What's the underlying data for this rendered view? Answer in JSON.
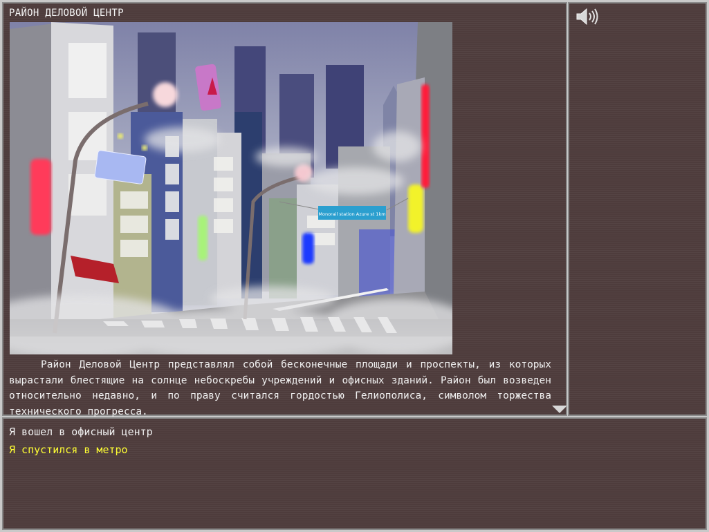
{
  "location": {
    "title": "РАЙОН ДЕЛОВОЙ ЦЕНТР"
  },
  "scene": {
    "signs": {
      "station": "Monorail station Azure st 1km"
    }
  },
  "description": "Район Деловой Центр представлял собой бесконечные площади и проспекты, из которых вырастали блестящие на солнце небоскребы учреждений и офисных зданий. Район был возведен относительно недавно, и по праву считался гордостью Гелиополиса, символом торжества технического прогресса.",
  "choices": [
    {
      "label": "Я вошел в офисный центр",
      "state": "normal"
    },
    {
      "label": "Я спустился в метро",
      "state": "highlighted"
    }
  ],
  "controls": {
    "sound_icon": "speaker-icon",
    "more_icon": "triangle-down-icon"
  },
  "colors": {
    "panel_bg": "#4e3c3c",
    "frame": "#c9c9c9",
    "text": "#f0f0f0",
    "highlight": "#ffff33"
  }
}
